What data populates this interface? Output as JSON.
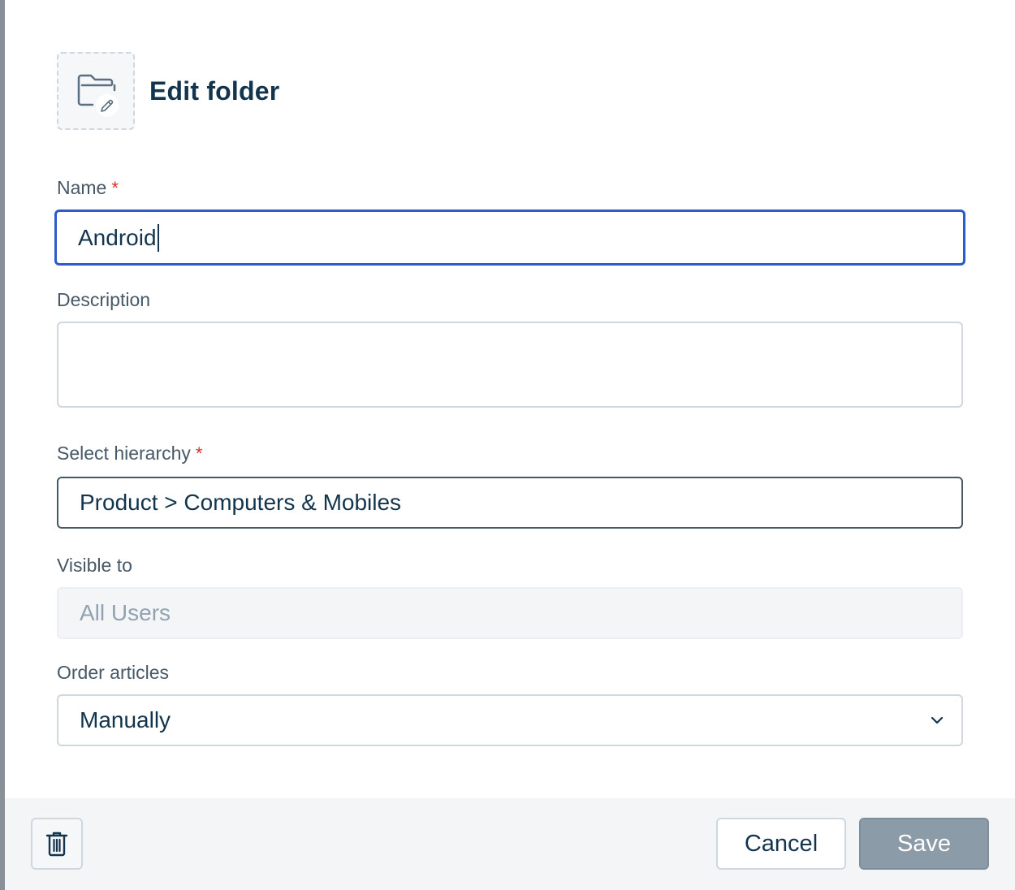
{
  "header": {
    "title": "Edit folder",
    "icon": "folder-edit-icon"
  },
  "form": {
    "name": {
      "label": "Name",
      "required_mark": "*",
      "value": "Android"
    },
    "description": {
      "label": "Description",
      "value": ""
    },
    "hierarchy": {
      "label": "Select hierarchy",
      "required_mark": "*",
      "value": "Product > Computers & Mobiles"
    },
    "visible_to": {
      "label": "Visible to",
      "value": "All Users"
    },
    "order_articles": {
      "label": "Order articles",
      "value": "Manually"
    }
  },
  "footer": {
    "delete_icon": "trash-icon",
    "cancel_label": "Cancel",
    "save_label": "Save"
  },
  "colors": {
    "focus_border": "#2c5cc5",
    "required": "#d72d30",
    "text_primary": "#12344d",
    "save_disabled": "#8c9ba8"
  }
}
